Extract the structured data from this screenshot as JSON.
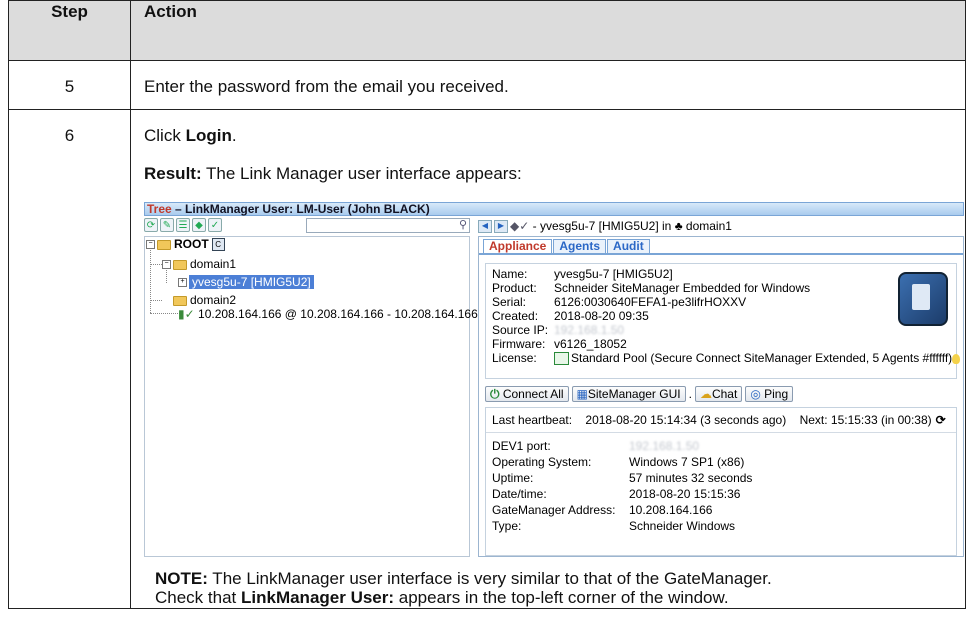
{
  "table": {
    "header": {
      "step": "Step",
      "action": "Action"
    },
    "rows": [
      {
        "step": "5",
        "action": "Enter the password from the email you received."
      },
      {
        "step": "6",
        "click_prefix": "Click ",
        "click_bold": "Login",
        "click_suffix": ".",
        "result_bold": "Result:",
        "result_text": " The Link Manager user interface appears:",
        "note_bold": "NOTE:",
        "note_text1": " The LinkManager user interface is very similar to that of the GateManager.",
        "note_text2_prefix": "Check that ",
        "note_text2_bold": "LinkManager User:",
        "note_text2_suffix": " appears in the top-left corner of the window."
      }
    ]
  },
  "screenshot": {
    "title_tree": "Tree",
    "title_rest": " – LinkManager User: LM-User (John BLACK)",
    "tree": {
      "root": "ROOT",
      "root_badge": "C",
      "domain1": "domain1",
      "appliance": "yvesg5u-7 [HMIG5U2]",
      "domain2": "domain2",
      "ip_entry": "10.208.164.166 @ 10.208.164.166 - 10.208.164.166"
    },
    "nav": {
      "text": " - yvesg5u-7 [HMIG5U2] in ",
      "domain": "domain1"
    },
    "tabs": [
      "Appliance",
      "Agents",
      "Audit"
    ],
    "info": {
      "name_k": "Name:",
      "name_v": "yvesg5u-7 [HMIG5U2]",
      "product_k": "Product:",
      "product_v": "Schneider SiteManager Embedded for Windows",
      "serial_k": "Serial:",
      "serial_v": "6126:0030640FEFA1-pe3lifrHOXXV",
      "created_k": "Created:",
      "created_v": "2018-08-20 09:35",
      "sourceip_k": "Source IP:",
      "sourceip_v": "192.168.1.50",
      "firmware_k": "Firmware:",
      "firmware_v": "v6126_18052",
      "license_k": "License:",
      "license_v": "Standard Pool (Secure Connect SiteManager Extended, 5 Agents #ffffff)"
    },
    "buttons": {
      "connect_all": "Connect All",
      "sitemanager_gui": "SiteManager GUI",
      "dot": ".",
      "chat": "Chat",
      "ping": "Ping"
    },
    "status": {
      "heartbeat_k": "Last heartbeat:",
      "heartbeat_v": "2018-08-20  15:14:34 (3 seconds ago)",
      "next": "Next: 15:15:33 (in 00:38)",
      "rows": [
        {
          "k": "DEV1 port:",
          "v": "192.168.1.50"
        },
        {
          "k": "Operating System:",
          "v": "Windows 7 SP1 (x86)"
        },
        {
          "k": "Uptime:",
          "v": "57 minutes 32 seconds"
        },
        {
          "k": "Date/time:",
          "v": "2018-08-20 15:15:36"
        },
        {
          "k": "GateManager Address:",
          "v": "10.208.164.166"
        },
        {
          "k": "Type:",
          "v": "Schneider Windows"
        }
      ]
    }
  }
}
